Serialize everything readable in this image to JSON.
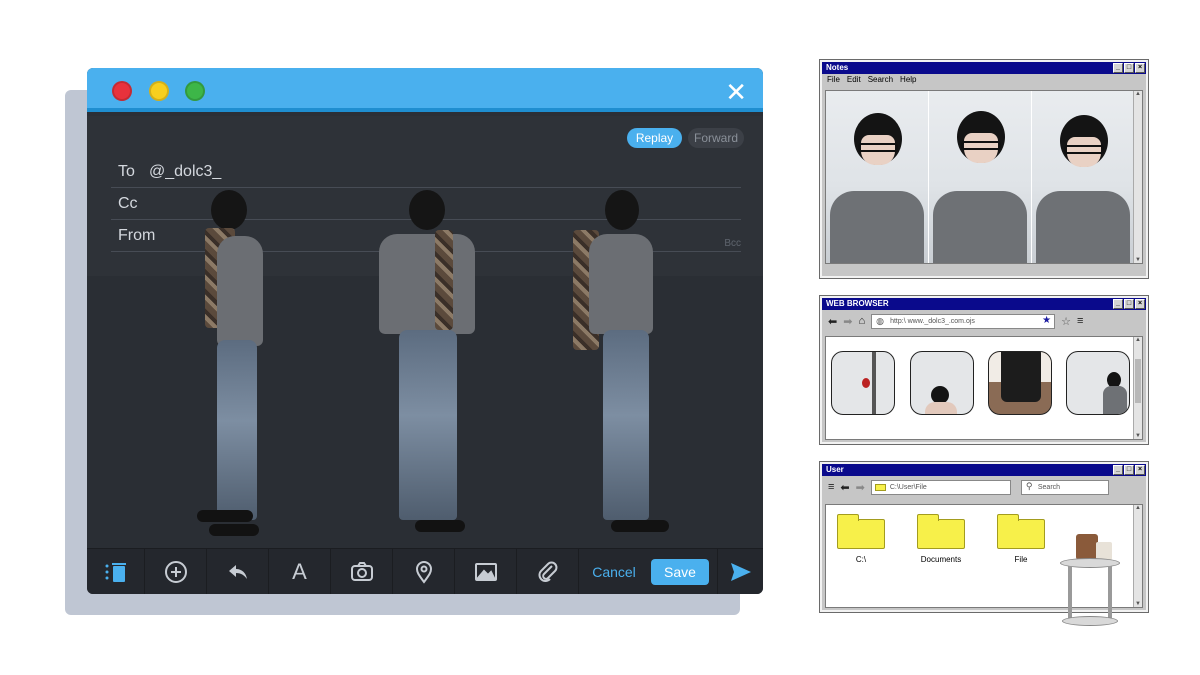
{
  "mail": {
    "close_label": "✕",
    "replay_label": "Replay",
    "forward_label": "Forward",
    "to_label": "To",
    "to_value": "@_dolc3_",
    "cc_label": "Cc",
    "from_label": "From",
    "bcc_label": "Bcc",
    "cancel_label": "Cancel",
    "save_label": "Save",
    "text_tool_label": "A",
    "accent": "#4ab0ee"
  },
  "notes": {
    "title": "Notes",
    "menu": [
      "File",
      "Edit",
      "Search",
      "Help"
    ]
  },
  "browser": {
    "title": "WEB BROWSER",
    "address": "http:\\ www._dolc3_.com.ojs"
  },
  "user": {
    "title": "User",
    "path": "C:\\User\\File",
    "search_placeholder": "Search",
    "folders": [
      "C:\\",
      "Documents",
      "File"
    ]
  }
}
